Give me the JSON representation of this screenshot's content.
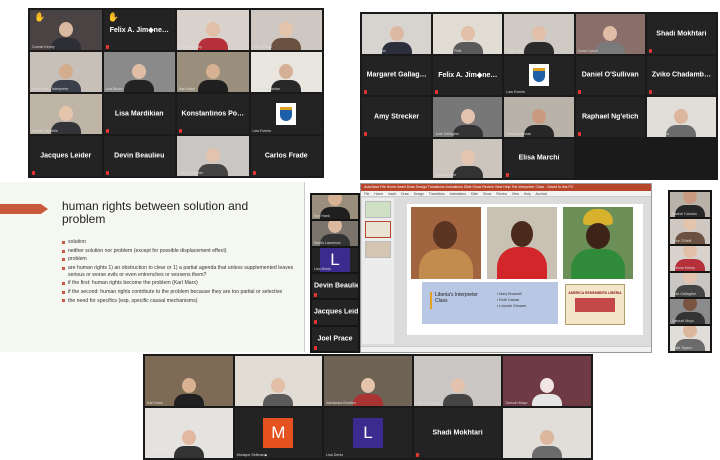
{
  "grid_top_left": {
    "rows": [
      [
        {
          "tag": "Connie Kenny",
          "raised_hand": true,
          "video": {
            "bg": "#4a4344",
            "skin": "#d9b8a0",
            "shirt": "#2d2d34"
          }
        },
        {
          "name": "Felix A. Jim◆ne…",
          "raised_hand": true
        },
        {
          "tag": "Joanna Kenny",
          "video": {
            "bg": "#d9d2cc",
            "skin": "#e2bfa7",
            "shirt": "#b5303a"
          }
        },
        {
          "tag": "Alice O'Neill",
          "video": {
            "bg": "#cfc8c2",
            "skin": "#e5c4ac",
            "shirt": "#6a5140"
          }
        }
      ],
      [
        {
          "tag": "Pan Chen – Interpreter",
          "video": {
            "bg": "#c6c0b8",
            "skin": "#d4ad8f",
            "shirt": "#3b3f4c"
          }
        },
        {
          "tag": "Lisa Bloom",
          "video": {
            "bg": "#8a8a8a",
            "skin": "#e0bea6",
            "shirt": "#222"
          }
        },
        {
          "tag": "Karl Hank",
          "active": true,
          "video": {
            "bg": "#9a8f7c",
            "skin": "#d7b193",
            "shirt": "#1f1f1f"
          }
        },
        {
          "tag": "Zviko Chadamba",
          "video": {
            "bg": "#e9e6e0",
            "skin": "#d6b096",
            "shirt": "#282828"
          }
        }
      ],
      [
        {
          "tag": "Natalie Vanbelle",
          "video": {
            "bg": "#bfb5a6",
            "skin": "#e4c4aa",
            "shirt": "#33333a"
          }
        },
        {
          "name": "Lisa Mardikian"
        },
        {
          "name": "Konstantinos Po…"
        },
        {
          "tag": "Law Events",
          "logo": true
        }
      ],
      [
        {
          "name": "Jacques Leider"
        },
        {
          "name": "Devin Beaulieu"
        },
        {
          "tag": "Julie Gallagher",
          "video": {
            "bg": "#c9c6c3",
            "skin": "#e3c3ae",
            "shirt": "#444"
          }
        },
        {
          "name": "Carlos Frade"
        }
      ]
    ]
  },
  "grid_top_right": {
    "rows": [
      [
        {
          "tag": "Anne Keegan",
          "video": {
            "bg": "#d7d4cf",
            "skin": "#dcb9a2",
            "shirt": "#2c2f3c"
          }
        },
        {
          "tag": "Marie-Luce Petit",
          "video": {
            "bg": "#e2ddd4",
            "skin": "#e2bfa6",
            "shirt": "#5a5a5a"
          }
        },
        {
          "tag": "Hugo Vale",
          "active": true,
          "video": {
            "bg": "#cfcac3",
            "skin": "#e1bfa9",
            "shirt": "#2b2b2b"
          }
        },
        {
          "tag": "Conor Lynch",
          "video": {
            "bg": "#8a6e6a",
            "skin": "#e0bda4",
            "shirt": "#7a7a7a"
          }
        },
        {
          "name": "Shadi Mokhtari"
        }
      ],
      [
        {
          "name": "Margaret Gallag…"
        },
        {
          "name": "Felix A. Jim◆ne…"
        },
        {
          "tag": "Law Events",
          "logo": true
        },
        {
          "name": "Daniel O'Sullivan"
        },
        {
          "name": "Zviko Chadamb…"
        }
      ],
      [
        {
          "name": "Amy Strecker"
        },
        {
          "tag": "Julie Gallagher",
          "video": {
            "bg": "#777",
            "skin": "#e3c3ae",
            "shirt": "#333"
          }
        },
        {
          "tag": "Rachel Carolan",
          "video": {
            "bg": "#b9b2a8",
            "skin": "#c99a80",
            "shirt": "#272727"
          }
        },
        {
          "name": "Raphael Ng'etich"
        },
        {
          "tag": "Haidi Vigano",
          "video": {
            "bg": "#e1ddd8",
            "skin": "#dcb79d",
            "shirt": "#6b6b6b"
          }
        }
      ],
      [
        {
          "tag": "Annabel Meir",
          "video": {
            "bg": "#cbc5bd",
            "skin": "#e4c5b0",
            "shirt": "#333"
          }
        },
        {
          "name": "Elisa Marchi"
        }
      ]
    ]
  },
  "slide": {
    "title": "human rights between solution and problem",
    "bullets": [
      "solution",
      "neither solution nor problem (except for possible displacement effect)",
      "problem",
      "are human rights 1) an obstruction to clear or 1) a partial agenda that unless supplemented leaves serious or worse evils or even entrenches or worsens them?",
      "if the first: human rights become the problem (Karl Marx)",
      "if the second: human rights contribute to the problem because they are too partial or selective",
      "the need for specifics (esp. specific causal mechanisms)"
    ]
  },
  "slide_sidebar": [
    {
      "tag": "Karl Hank",
      "active": true,
      "video": {
        "bg": "#9a8f7c",
        "skin": "#d7b193",
        "shirt": "#1f1f1f"
      }
    },
    {
      "tag": "Martin Lawrence",
      "video": {
        "bg": "#7a746c",
        "skin": "#dbb89e",
        "shirt": "#333"
      }
    },
    {
      "tag": "Lisa Dentz",
      "avatar": "L",
      "avatar_color": "#3c2b8f"
    },
    {
      "name": "Devin Beaulieu"
    },
    {
      "name": "Jacques Leider"
    },
    {
      "name": "Joel Prace"
    }
  ],
  "ppt": {
    "titlebar": "AutoSave   File   Home   Insert   Draw   Design   Transitions   Animations   Slide Show   Review   View   Help   The Interpreter Class - Saved to this PC",
    "ribbon": "File Home Insert Draw Design Transitions Animations Slide Show Review View Help Acrobat",
    "info_label": "Liberia's Interpreter Class",
    "names": [
      "Mary Brownell",
      "Ruth Caesar",
      "Leymah Gbowee"
    ],
    "poster_title": "AMERICA REMEMBERS LIBERIA"
  },
  "ppt_sidebar": [
    {
      "tag": "Rachel Carolan",
      "video": {
        "bg": "#b9b2a8",
        "skin": "#c99a80",
        "shirt": "#272727"
      }
    },
    {
      "tag": "Alice O'Neill",
      "video": {
        "bg": "#cfc8c2",
        "skin": "#e5c4ac",
        "shirt": "#6a5140"
      }
    },
    {
      "tag": "Joanna Kenny",
      "video": {
        "bg": "#d9d2cc",
        "skin": "#e2bfa7",
        "shirt": "#b5303a"
      }
    },
    {
      "tag": "Julie Gallagher",
      "active": true,
      "video": {
        "bg": "#c9c6c3",
        "skin": "#e3c3ae",
        "shirt": "#444"
      }
    },
    {
      "tag": "Samuel Moyo",
      "video": {
        "bg": "#8b8b8b",
        "skin": "#7a5440",
        "shirt": "#333"
      }
    },
    {
      "tag": "Haidi Vigano",
      "video": {
        "bg": "#e1ddd8",
        "skin": "#dcb79d",
        "shirt": "#6b6b6b"
      }
    }
  ],
  "grid_bottom": {
    "rows": [
      [
        {
          "tag": "Karl Hank",
          "video": {
            "bg": "#7d6b55",
            "skin": "#d9b293",
            "shirt": "#202020"
          }
        },
        {
          "tag": "Marie-Luce Petit",
          "video": {
            "bg": "#e2ddd4",
            "skin": "#e2bfa6",
            "shirt": "#5a5a5a"
          }
        },
        {
          "tag": "Alexandra Bodden",
          "video": {
            "bg": "#6e6354",
            "skin": "#e4c4aa",
            "shirt": "#a33"
          }
        },
        {
          "tag": "Julie Gallagher",
          "active": true,
          "video": {
            "bg": "#c9c6c3",
            "skin": "#e3c3ae",
            "shirt": "#444"
          }
        },
        {
          "tag": "Samuel Moyo",
          "video": {
            "bg": "#6e3b45",
            "skin": "#f2e6e2",
            "shirt": "#e5e5e5"
          }
        }
      ],
      [
        {
          "tag": "Orlon Vallery",
          "video": {
            "bg": "#e5e3e0",
            "skin": "#e0b9a0",
            "shirt": "#333"
          }
        },
        {
          "tag": "Monique Sellman◆",
          "avatar": "M",
          "avatar_color": "#e5521f"
        },
        {
          "tag": "Lisa Dentz",
          "avatar": "L",
          "avatar_color": "#3c2b8f"
        },
        {
          "name": "Shadi Mokhtari"
        },
        {
          "tag": "Haidi Vigano",
          "video": {
            "bg": "#e1ddd8",
            "skin": "#dcb79d",
            "shirt": "#6b6b6b"
          }
        }
      ]
    ]
  }
}
